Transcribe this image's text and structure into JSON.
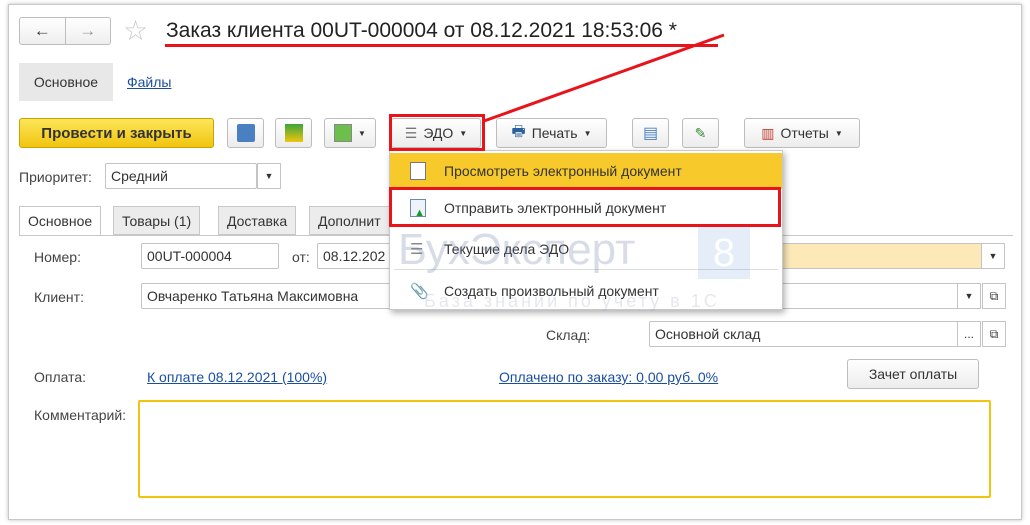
{
  "window": {
    "title": "Заказ клиента 00UT-000004 от 08.12.2021 18:53:06 *"
  },
  "nav": {
    "back": "←",
    "forward": "→"
  },
  "top_tabs": [
    {
      "label": "Основное",
      "active": true
    },
    {
      "label": "Файлы"
    }
  ],
  "toolbar": {
    "post_close": "Провести и закрыть",
    "edo": "ЭДО",
    "print": "Печать",
    "reports": "Отчеты"
  },
  "edo_menu": [
    {
      "label": "Просмотреть электронный документ",
      "icon": "document-icon",
      "highlighted": true
    },
    {
      "label": "Отправить электронный документ",
      "icon": "send-document-icon",
      "outlined": true
    },
    {
      "label": "Текущие дела ЭДО",
      "icon": "edo-icon"
    },
    {
      "label": "Создать произвольный документ",
      "icon": "paperclip-icon"
    }
  ],
  "priority": {
    "label": "Приоритет:",
    "value": "Средний"
  },
  "form_tabs": [
    "Основное",
    "Товары (1)",
    "Доставка",
    "Дополнит"
  ],
  "form": {
    "number_label": "Номер:",
    "number": "00UT-000004",
    "from_label": "от:",
    "date": "08.12.202",
    "client_label": "Клиент:",
    "client": "Овчаренко Татьяна Максимовна",
    "warehouse_label": "Склад:",
    "warehouse": "Основной склад",
    "payment_label": "Оплата:",
    "payment_link": "К оплате 08.12.2021 (100%)",
    "paid_link": "Оплачено по заказу: 0,00 руб. 0%",
    "offset_button": "Зачет оплаты",
    "comment_label": "Комментарий:",
    "comment": ""
  },
  "watermark": {
    "brand": "БухЭксперт",
    "badge": "8",
    "tagline": "База знаний по учету в 1С"
  },
  "colors": {
    "accent_yellow": "#f7d21e",
    "highlight": "#f8c92a",
    "annotation_red": "#e8141b",
    "link": "#1a4fa0"
  }
}
